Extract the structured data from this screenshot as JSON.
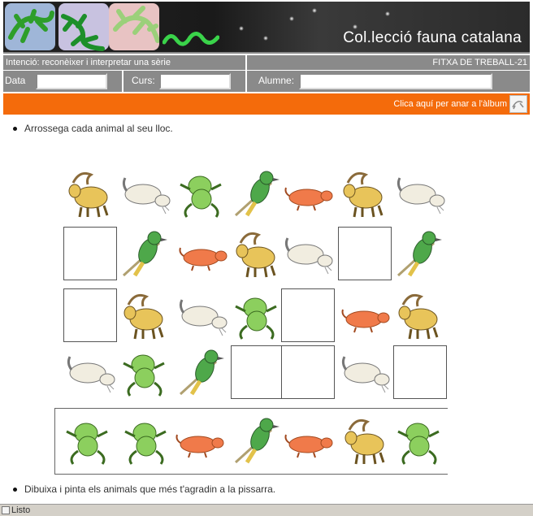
{
  "header": {
    "title": "Col.lecció fauna catalana"
  },
  "info": {
    "intent": "Intenció: reconèixer i interpretar una sèrie",
    "sheet": "FITXA DE TREBALL-21"
  },
  "form": {
    "date_label": "Data",
    "date_value": "",
    "course_label": "Curs:",
    "course_value": "",
    "student_label": "Alumne:",
    "student_value": ""
  },
  "album_link": "Clica aquí per anar a l'àlbum",
  "instructions": [
    "Arrossega cada animal al seu lloc.",
    "Dibuixa i pinta els animals que més t'agradin a la pissarra."
  ],
  "grid": {
    "rows": [
      [
        "goat",
        "ermine",
        "frog",
        "bird",
        "hamster",
        "goat",
        "ermine"
      ],
      [
        "empty",
        "bird",
        "hamster",
        "goat",
        "ermine",
        "empty",
        "bird"
      ],
      [
        "empty",
        "goat",
        "ermine",
        "frog",
        "empty",
        "hamster",
        "goat"
      ],
      [
        "ermine",
        "frog",
        "bird",
        "empty",
        "empty",
        "ermine",
        "empty"
      ]
    ],
    "answers": [
      "frog",
      "frog",
      "hamster",
      "bird",
      "hamster",
      "goat",
      "frog"
    ]
  },
  "colors": {
    "orange_bar": "#f46b0b",
    "gray_bar": "#8a8a8a",
    "goat": "#e8c45a",
    "ermine": "#f1ede0",
    "frog": "#8ccf5e",
    "bird": "#4ea84a",
    "hamster": "#f07a4a"
  },
  "status": {
    "text": "Listo"
  }
}
